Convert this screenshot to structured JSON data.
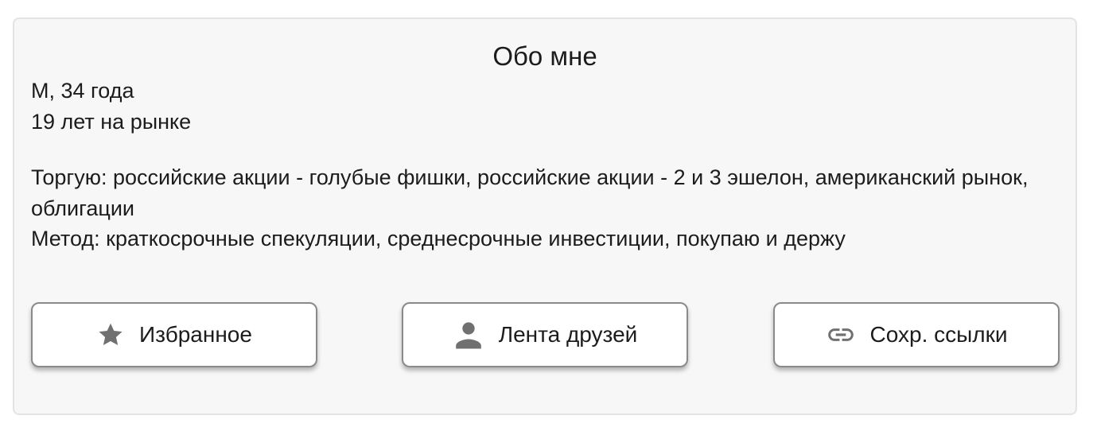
{
  "about": {
    "title": "Обо мне",
    "lines": [
      "М, 34 года",
      "19 лет на рынке"
    ],
    "trade": "Торгую: российские акции - голубые фишки, российские акции - 2 и 3 эшелон, американский рынок, облигации",
    "method": "Метод: краткосрочные спекуляции, среднесрочные инвестиции, покупаю и держу"
  },
  "buttons": [
    {
      "label": "Избранное",
      "icon": "star-icon"
    },
    {
      "label": "Лента друзей",
      "icon": "person-icon"
    },
    {
      "label": "Сохр. ссылки",
      "icon": "link-icon"
    }
  ],
  "colors": {
    "card_background": "#f7f7f7",
    "card_border": "#e3e3e3",
    "button_border": "#8a8a8a",
    "icon_gray": "#707070",
    "text": "#1c1c1c"
  }
}
